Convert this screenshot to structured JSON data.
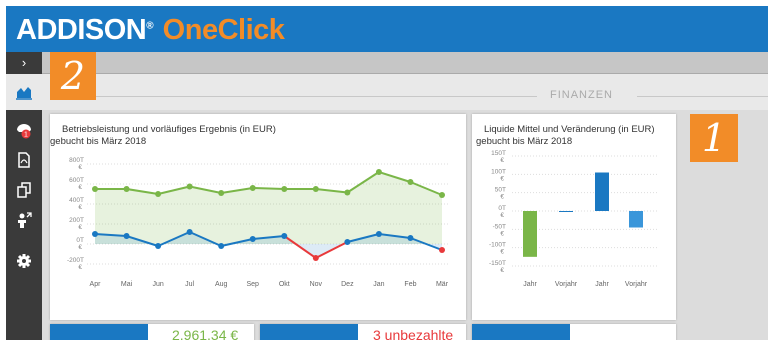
{
  "header": {
    "brand_main": "ADDISON",
    "brand_reg": "®",
    "brand_accent": "OneClick"
  },
  "toolbar": {
    "toggle_label": "›"
  },
  "section": {
    "title": "FINANZEN"
  },
  "sidebar": {
    "items": [
      {
        "icon": "chart-icon",
        "active": true
      },
      {
        "icon": "notifications-icon",
        "badge": "1"
      },
      {
        "icon": "pdf-icon"
      },
      {
        "icon": "copy-icon"
      },
      {
        "icon": "user-share-icon"
      },
      {
        "icon": "gear-icon"
      }
    ]
  },
  "annotations": {
    "badge1": "1",
    "badge2": "2"
  },
  "colors": {
    "header": "#1a78c2",
    "accent": "#f28c28",
    "green": "#7ab648",
    "blue": "#1a78c2",
    "red": "#e8393b"
  },
  "chart_data": [
    {
      "type": "line",
      "title": "Betriebsleistung und vorläufiges Ergebnis (in EUR)",
      "subtitle": "gebucht bis März 2018",
      "categories": [
        "Apr",
        "Mai",
        "Jun",
        "Jul",
        "Aug",
        "Sep",
        "Okt",
        "Nov",
        "Dez",
        "Jan",
        "Feb",
        "Mär"
      ],
      "y_ticks": [
        "800T €",
        "600T €",
        "400T €",
        "200T €",
        "0T €",
        "-200T €"
      ],
      "ylim": [
        -200,
        800
      ],
      "series": [
        {
          "name": "",
          "values": [
            550,
            550,
            500,
            575,
            510,
            560,
            550,
            550,
            515,
            720,
            620,
            490
          ]
        },
        {
          "name": "",
          "values": [
            100,
            80,
            -20,
            120,
            -20,
            50,
            80,
            -140,
            20,
            100,
            60,
            -60
          ]
        }
      ],
      "grid": true
    },
    {
      "type": "bar",
      "title": "Liquide Mittel und Veränderung (in EUR)",
      "subtitle": "gebucht bis März 2018",
      "categories": [
        "Jahr",
        "Vorjahr",
        "Jahr",
        "Vorjahr"
      ],
      "y_ticks": [
        "150T €",
        "100T €",
        "50T €",
        "0T €",
        "-50T €",
        "-100T €",
        "-150T €"
      ],
      "ylim": [
        -150,
        150
      ],
      "bars": [
        {
          "from": 0,
          "to": -125,
          "color": "#7ab648"
        },
        {
          "from": 0,
          "to": 0,
          "color": "#1a78c2"
        },
        {
          "from": 0,
          "to": 105,
          "color": "#1a78c2"
        },
        {
          "from": 0,
          "to": -45,
          "color": "#3a96da"
        }
      ]
    }
  ],
  "tiles": {
    "value1": "2.961,34 €",
    "value2": "3 unbezahlte"
  }
}
